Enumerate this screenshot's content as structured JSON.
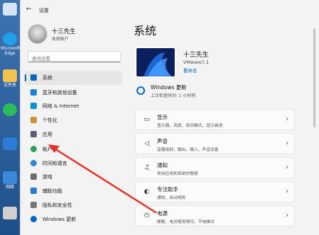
{
  "desktop": {
    "icons": [
      {
        "label": "",
        "color": "#d6e4f5"
      },
      {
        "label": "Microsoft Edge",
        "color": "#1ea1e8"
      },
      {
        "label": "文件夹",
        "color": "#f2c14e"
      },
      {
        "label": "",
        "color": "#2bbd5a"
      },
      {
        "label": "",
        "color": "#2c7bd6"
      },
      {
        "label": "网络",
        "color": "#3b8ad9"
      },
      {
        "label": "",
        "color": "#cfcfcf"
      }
    ]
  },
  "window": {
    "title": "设置",
    "back_glyph": "←"
  },
  "account": {
    "name": "十三先生",
    "subtitle": "本地帐户"
  },
  "search": {
    "placeholder": "查找设置"
  },
  "nav": [
    {
      "label": "系统",
      "color": "#0067c0",
      "selected": true
    },
    {
      "label": "蓝牙和其他设备",
      "color": "#1b7fd6",
      "selected": false
    },
    {
      "label": "网络 & Internet",
      "color": "#0a8fd0",
      "selected": false
    },
    {
      "label": "个性化",
      "color": "#c8913a",
      "selected": false
    },
    {
      "label": "应用",
      "color": "#5b5b7a",
      "selected": false
    },
    {
      "label": "帐户",
      "color": "#2aa25d",
      "selected": false
    },
    {
      "label": "时间和语言",
      "color": "#2f86cf",
      "selected": false
    },
    {
      "label": "游戏",
      "color": "#6c6c6c",
      "selected": false
    },
    {
      "label": "辅助功能",
      "color": "#2a7ad1",
      "selected": false
    },
    {
      "label": "隐私和安全性",
      "color": "#777777",
      "selected": false
    },
    {
      "label": "Windows 更新",
      "color": "#0067c0",
      "selected": false
    }
  ],
  "main": {
    "title": "系统",
    "pc_name": "十三先生",
    "pc_model": "VMware7,1",
    "rename_label": "重命名",
    "update": {
      "title": "Windows 更新",
      "subtitle": "上次检查时间: 1 小时前"
    },
    "cards": [
      {
        "icon": "display-icon",
        "glyph": "▭",
        "title": "显示",
        "subtitle": "显示器、亮度、夜间模式、显示描述"
      },
      {
        "icon": "sound-icon",
        "glyph": "◁",
        "title": "声音",
        "subtitle": "音量级别、输出、输入、声音设备"
      },
      {
        "icon": "notification-icon",
        "glyph": "♫",
        "title": "通知",
        "subtitle": "来自应用和系统的警报"
      },
      {
        "icon": "focus-icon",
        "glyph": "◐",
        "title": "专注助手",
        "subtitle": "通知、自动规则"
      },
      {
        "icon": "power-icon",
        "glyph": "⏻",
        "title": "电源",
        "subtitle": "睡眠、电池使用情况、节电模式"
      }
    ],
    "chevron": "›"
  },
  "colors": {
    "accent": "#0067c0",
    "annotation_arrow": "#e5332a"
  }
}
